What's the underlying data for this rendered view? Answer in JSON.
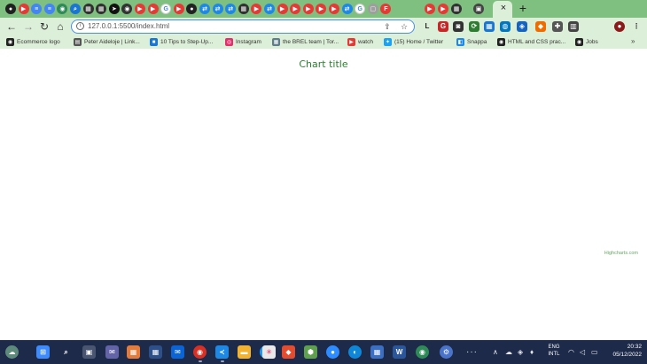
{
  "browser": {
    "tab_icons": [
      {
        "name": "github-tab-icon",
        "color": "#202020",
        "glyph": "●"
      },
      {
        "name": "youtube-tab-icon",
        "color": "#e53935",
        "glyph": "▶"
      },
      {
        "name": "docs-tab-icon",
        "color": "#4285f4",
        "glyph": "≡"
      },
      {
        "name": "docs-tab-icon",
        "color": "#4285f4",
        "glyph": "≡"
      },
      {
        "name": "chrome-tab-icon",
        "color": "#2e8b57",
        "glyph": "◉"
      },
      {
        "name": "search-tab-icon",
        "color": "#1976d2",
        "glyph": "⌕"
      },
      {
        "name": "gallery-tab-icon",
        "color": "#303030",
        "glyph": "▦"
      },
      {
        "name": "gallery-tab-icon",
        "color": "#303030",
        "glyph": "▦"
      },
      {
        "name": "arrow-tab-icon",
        "color": "#111111",
        "glyph": "➤"
      },
      {
        "name": "chrome-tab-icon",
        "color": "#333333",
        "glyph": "◉"
      },
      {
        "name": "youtube-tab-icon",
        "color": "#e53935",
        "glyph": "▶"
      },
      {
        "name": "youtube-tab-icon",
        "color": "#e53935",
        "glyph": "▶"
      },
      {
        "name": "google-tab-icon",
        "color": "#ffffff",
        "glyph": "G"
      },
      {
        "name": "youtube-tab-icon",
        "color": "#e53935",
        "glyph": "▶"
      },
      {
        "name": "record-tab-icon",
        "color": "#222222",
        "glyph": "●"
      },
      {
        "name": "translate-tab-icon",
        "color": "#1e88e5",
        "glyph": "⇄"
      },
      {
        "name": "translate-tab-icon",
        "color": "#1e88e5",
        "glyph": "⇄"
      },
      {
        "name": "translate-tab-icon",
        "color": "#1e88e5",
        "glyph": "⇄"
      },
      {
        "name": "gallery-tab-icon",
        "color": "#303030",
        "glyph": "▦"
      },
      {
        "name": "youtube-tab-icon",
        "color": "#e53935",
        "glyph": "▶"
      },
      {
        "name": "translate-tab-icon",
        "color": "#1e88e5",
        "glyph": "⇄"
      },
      {
        "name": "youtube-tab-icon",
        "color": "#e53935",
        "glyph": "▶"
      },
      {
        "name": "youtube-tab-icon",
        "color": "#e53935",
        "glyph": "▶"
      },
      {
        "name": "youtube-tab-icon",
        "color": "#e53935",
        "glyph": "▶"
      },
      {
        "name": "youtube-tab-icon",
        "color": "#e53935",
        "glyph": "▶"
      },
      {
        "name": "youtube-tab-icon",
        "color": "#e53935",
        "glyph": "▶"
      },
      {
        "name": "translate-tab-icon",
        "color": "#1e88e5",
        "glyph": "⇄"
      },
      {
        "name": "google-tab-icon",
        "color": "#ffffff",
        "glyph": "G"
      },
      {
        "name": "page-tab-icon",
        "color": "#9e9e9e",
        "glyph": "▢"
      },
      {
        "name": "figma-tab-icon",
        "color": "#e53935",
        "glyph": "F"
      },
      {
        "name": "youtube-tab-icon",
        "color": "#e53935",
        "glyph": "▶"
      },
      {
        "name": "youtube-tab-icon",
        "color": "#e53935",
        "glyph": "▶"
      },
      {
        "name": "gallery-tab-icon",
        "color": "#303030",
        "glyph": "▦"
      },
      {
        "name": "rss-tab-icon",
        "color": "#444444",
        "glyph": "▣"
      }
    ],
    "active_tab_close": "×",
    "new_tab": "+",
    "address": "127.0.0.1:5500/index.html",
    "nav": {
      "back": "←",
      "forward": "→",
      "reload": "↻",
      "home": "⌂"
    },
    "extensions": [
      {
        "name": "l-extension-icon",
        "color": "#222222",
        "glyph": "L"
      },
      {
        "name": "grammar-extension-icon",
        "color": "#c62828",
        "glyph": "G"
      },
      {
        "name": "camera-extension-icon",
        "color": "#333333",
        "glyph": "◙"
      },
      {
        "name": "cycle-extension-icon",
        "color": "#2e7d32",
        "glyph": "⟳"
      },
      {
        "name": "grid-extension-icon",
        "color": "#1976d2",
        "glyph": "▦"
      },
      {
        "name": "globe-extension-icon",
        "color": "#0277bd",
        "glyph": "◍"
      },
      {
        "name": "blue-extension-icon",
        "color": "#1565c0",
        "glyph": "◈"
      },
      {
        "name": "fox-extension-icon",
        "color": "#ef6c00",
        "glyph": "◆"
      },
      {
        "name": "puzzle-extension-icon",
        "color": "#555555",
        "glyph": "✚"
      },
      {
        "name": "sidebar-icon",
        "color": "#444444",
        "glyph": "▥"
      },
      {
        "name": "profile-avatar",
        "color": "#8b1a1a",
        "glyph": "●"
      },
      {
        "name": "menu-icon",
        "color": "#333333",
        "glyph": "⋮"
      }
    ],
    "bookmarks": [
      {
        "label": "Ecommerce logo",
        "color": "#222222",
        "glyph": "◉"
      },
      {
        "label": "Peter Aideloje | Link...",
        "color": "#555555",
        "glyph": "▤"
      },
      {
        "label": "10 Tips to Step-Up...",
        "color": "#1976d2",
        "glyph": "■"
      },
      {
        "label": "Instagram",
        "color": "#e1306c",
        "glyph": "◎"
      },
      {
        "label": "the BREL team | Tor...",
        "color": "#607d8b",
        "glyph": "▦"
      },
      {
        "label": "watch",
        "color": "#e53935",
        "glyph": "▶"
      },
      {
        "label": "(15) Home / Twitter",
        "color": "#1da1f2",
        "glyph": "✦"
      },
      {
        "label": "Snappa",
        "color": "#1e88e5",
        "glyph": "◧"
      },
      {
        "label": "HTML and CSS prac...",
        "color": "#222222",
        "glyph": "◉"
      },
      {
        "label": "Jobs",
        "color": "#222222",
        "glyph": "◉"
      }
    ],
    "bookmarks_more": "»"
  },
  "page": {
    "chart_title": "Chart title",
    "credits": "Highcharts.com",
    "title_color": "#2e7d32"
  },
  "taskbar": {
    "apps": [
      {
        "name": "weather-icon",
        "color": "#5d8a7a",
        "glyph": "☁",
        "round": true
      },
      {
        "name": "start-icon",
        "color": "#3d8bfd",
        "glyph": "⊞",
        "round": false
      },
      {
        "name": "search-icon",
        "color": "#1d2a4a",
        "glyph": "⌕",
        "round": false
      },
      {
        "name": "task-view-icon",
        "color": "#4a5572",
        "glyph": "▣",
        "round": false
      },
      {
        "name": "chat-icon",
        "color": "#6264a7",
        "glyph": "✉",
        "round": false
      },
      {
        "name": "store-icon",
        "color": "#e57b3a",
        "glyph": "▦",
        "round": false
      },
      {
        "name": "apps-grid-icon",
        "color": "#2d4f8a",
        "glyph": "▦",
        "round": false
      },
      {
        "name": "mail-icon",
        "color": "#0a64d6",
        "glyph": "✉",
        "round": false
      },
      {
        "name": "chrome-icon",
        "color": "#d93025",
        "glyph": "◉",
        "round": true
      },
      {
        "name": "vscode-icon",
        "color": "#1e88e5",
        "glyph": "≺",
        "round": false
      },
      {
        "name": "folder-icon",
        "color": "#f1b330",
        "glyph": "▬",
        "round": false
      },
      {
        "name": "docker-icon",
        "color": "#2496ed",
        "glyph": "◈",
        "round": true
      },
      {
        "name": "slack-icon",
        "color": "#e8e8e8",
        "glyph": "✳",
        "round": false
      },
      {
        "name": "git-icon",
        "color": "#e44c30",
        "glyph": "◆",
        "round": false
      },
      {
        "name": "node-icon",
        "color": "#5fa04e",
        "glyph": "⬢",
        "round": false
      },
      {
        "name": "zoom-icon",
        "color": "#2d8cff",
        "glyph": "●",
        "round": true
      },
      {
        "name": "edge-icon",
        "color": "#0f87d8",
        "glyph": "◐",
        "round": true
      },
      {
        "name": "calendar-icon",
        "color": "#3a6fc4",
        "glyph": "▦",
        "round": false
      },
      {
        "name": "word-icon",
        "color": "#2b579a",
        "glyph": "W",
        "round": false
      },
      {
        "name": "chrome-icon",
        "color": "#2e8b57",
        "glyph": "◉",
        "round": true
      },
      {
        "name": "settings-icon",
        "color": "#4a74c9",
        "glyph": "⚙",
        "round": true
      }
    ],
    "overflow": "···",
    "tray": {
      "chevron": "∧",
      "cloud": "☁",
      "mic": "🎙",
      "wifi": "◠",
      "volume": "◁",
      "battery": "▭"
    },
    "lang_top": "ENG",
    "lang_bottom": "INTL",
    "time": "20:32",
    "date": "05/12/2022"
  }
}
